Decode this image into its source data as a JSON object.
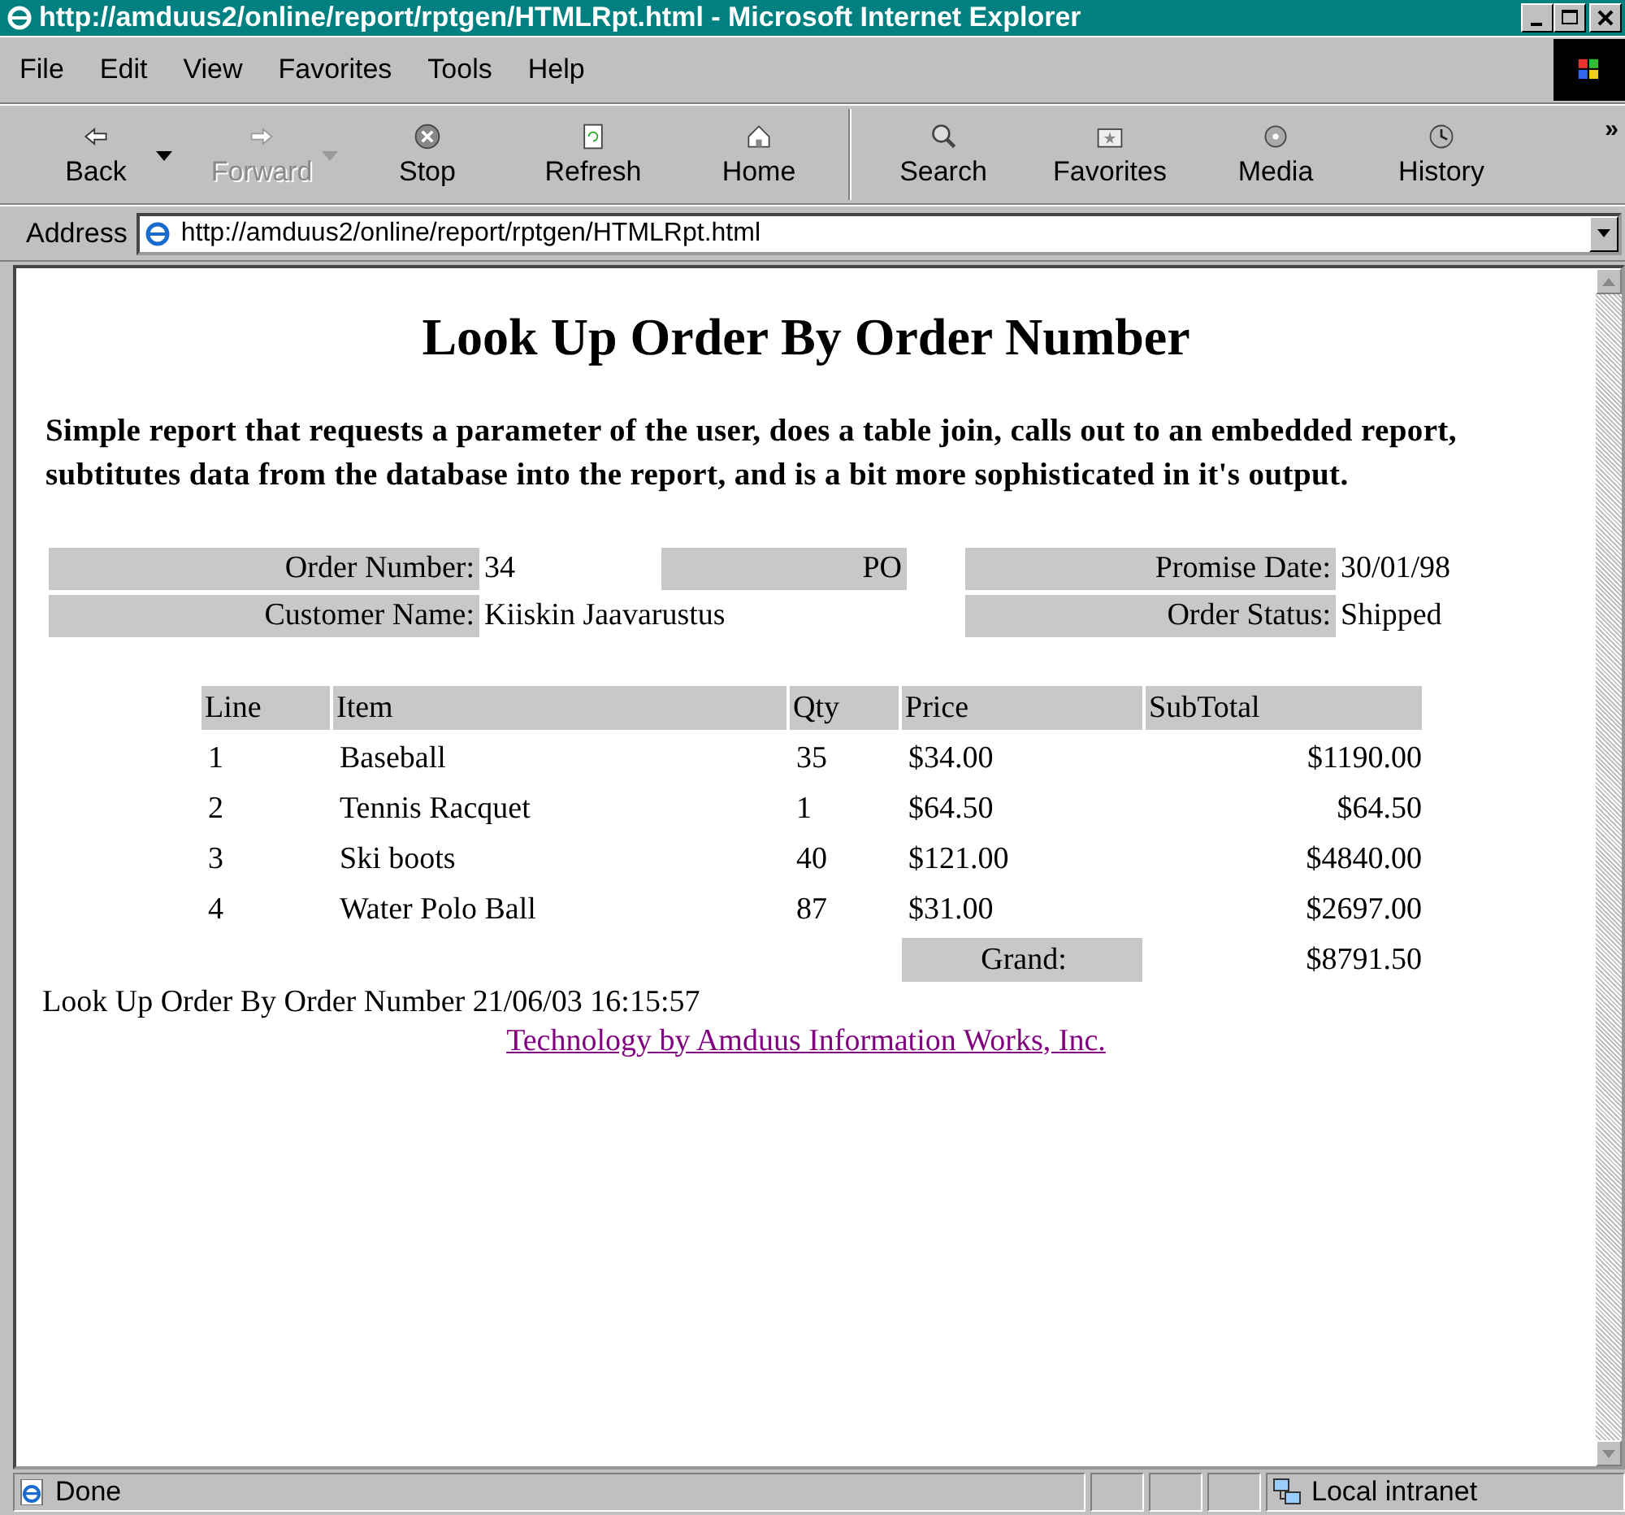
{
  "window": {
    "title": "http://amduus2/online/report/rptgen/HTMLRpt.html - Microsoft Internet Explorer"
  },
  "menu": [
    "File",
    "Edit",
    "View",
    "Favorites",
    "Tools",
    "Help"
  ],
  "toolbar": [
    {
      "label": "Back",
      "kind": "back",
      "disabled": false,
      "dropdown": true
    },
    {
      "label": "Forward",
      "kind": "forward",
      "disabled": true,
      "dropdown": true
    },
    {
      "label": "Stop",
      "kind": "stop",
      "disabled": false,
      "dropdown": false
    },
    {
      "label": "Refresh",
      "kind": "refresh",
      "disabled": false,
      "dropdown": false
    },
    {
      "label": "Home",
      "kind": "home",
      "disabled": false,
      "dropdown": false
    },
    {
      "label": "Search",
      "kind": "search",
      "disabled": false,
      "dropdown": false,
      "separator_before": true
    },
    {
      "label": "Favorites",
      "kind": "favorites",
      "disabled": false,
      "dropdown": false
    },
    {
      "label": "Media",
      "kind": "media",
      "disabled": false,
      "dropdown": false
    },
    {
      "label": "History",
      "kind": "history",
      "disabled": false,
      "dropdown": false
    }
  ],
  "toolbar_more": "»",
  "address": {
    "label": "Address",
    "value": "http://amduus2/online/report/rptgen/HTMLRpt.html"
  },
  "page": {
    "heading": "Look Up Order By Order Number",
    "description": "Simple report that requests a parameter of the user, does a table join, calls out to an embedded report, subtitutes data from the database into the report, and is a bit more sophisticated in it's output.",
    "order_info": {
      "order_number_label": "Order Number:",
      "order_number": "34",
      "po_label": "PO",
      "promise_date_label": "Promise Date:",
      "promise_date": "30/01/98",
      "customer_name_label": "Customer Name:",
      "customer_name": "Kiiskin Jaavarustus",
      "order_status_label": "Order Status:",
      "order_status": "Shipped"
    },
    "lines": {
      "columns": [
        "Line",
        "Item",
        "Qty",
        "Price",
        "SubTotal"
      ],
      "rows": [
        [
          "1",
          "Baseball",
          "35",
          "$34.00",
          "$1190.00"
        ],
        [
          "2",
          "Tennis Racquet",
          "1",
          "$64.50",
          "$64.50"
        ],
        [
          "3",
          "Ski boots",
          "40",
          "$121.00",
          "$4840.00"
        ],
        [
          "4",
          "Water Polo Ball",
          "87",
          "$31.00",
          "$2697.00"
        ]
      ],
      "grand_label": "Grand:",
      "grand_total": "$8791.50"
    },
    "footer": "Look Up Order By Order Number 21/06/03 16:15:57",
    "credit_link": "Technology by Amduus Information Works, Inc."
  },
  "status_bar": {
    "text": "Done",
    "zone": "Local intranet"
  }
}
